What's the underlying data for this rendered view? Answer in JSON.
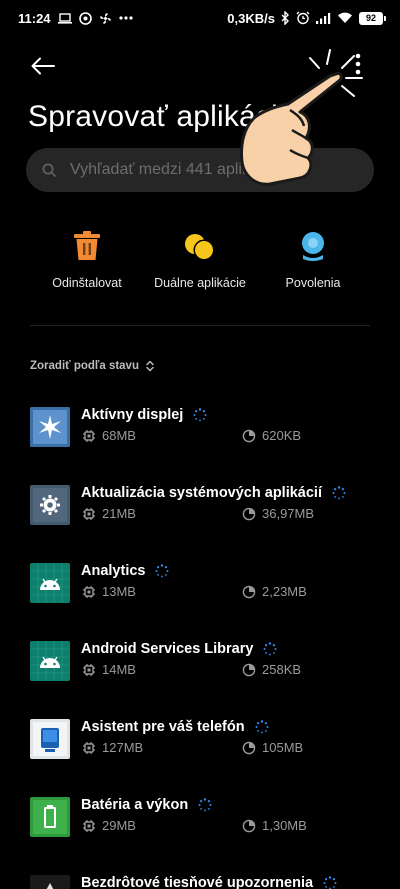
{
  "status_bar": {
    "time": "11:24",
    "left_icons": [
      "laptop-icon",
      "vpn-icon",
      "fan-icon",
      "more-dots-icon"
    ],
    "net_speed": "0,3KB/s",
    "right_icons": [
      "bluetooth-icon",
      "alarm-icon",
      "signal-icon",
      "wifi-icon"
    ],
    "battery": "92"
  },
  "header": {
    "title": "Spravovať aplikácie",
    "back_icon": "back-arrow-icon",
    "more_icon": "more-vertical-icon"
  },
  "search": {
    "placeholder": "Vyhľadať medzi 441 aplikáciami"
  },
  "actions": [
    {
      "label": "Odinštalovat",
      "icon": "trash-icon",
      "color": "#f28a34"
    },
    {
      "label": "Duálne aplikácie",
      "icon": "dual-apps-icon",
      "color": "#f7c61c"
    },
    {
      "label": "Povolenia",
      "icon": "permissions-icon",
      "color": "#4bb6ea"
    }
  ],
  "sort": {
    "label": "Zoradiť podľa stavu",
    "icon": "sort-updown-icon"
  },
  "apps": [
    {
      "name": "Aktívny displej",
      "storage": "68MB",
      "cache": "620KB",
      "icon": "active-display-icon"
    },
    {
      "name": "Aktualizácia systémových aplikácií",
      "storage": "21MB",
      "cache": "36,97MB",
      "icon": "system-update-icon"
    },
    {
      "name": "Analytics",
      "storage": "13MB",
      "cache": "2,23MB",
      "icon": "android-icon"
    },
    {
      "name": "Android Services Library",
      "storage": "14MB",
      "cache": "258KB",
      "icon": "android-icon"
    },
    {
      "name": "Asistent pre váš telefón",
      "storage": "127MB",
      "cache": "105MB",
      "icon": "assistant-icon"
    },
    {
      "name": "Batéria a výkon",
      "storage": "29MB",
      "cache": "1,30MB",
      "icon": "battery-icon"
    },
    {
      "name": "Bezdrôtové tiesňové upozornenia",
      "storage": "",
      "cache": "",
      "icon": "emergency-alert-icon"
    }
  ],
  "colors": {
    "background": "#000000",
    "search_bg": "#262626",
    "spinner": "#2f8bf2",
    "secondary_text": "#9a9a9a"
  }
}
